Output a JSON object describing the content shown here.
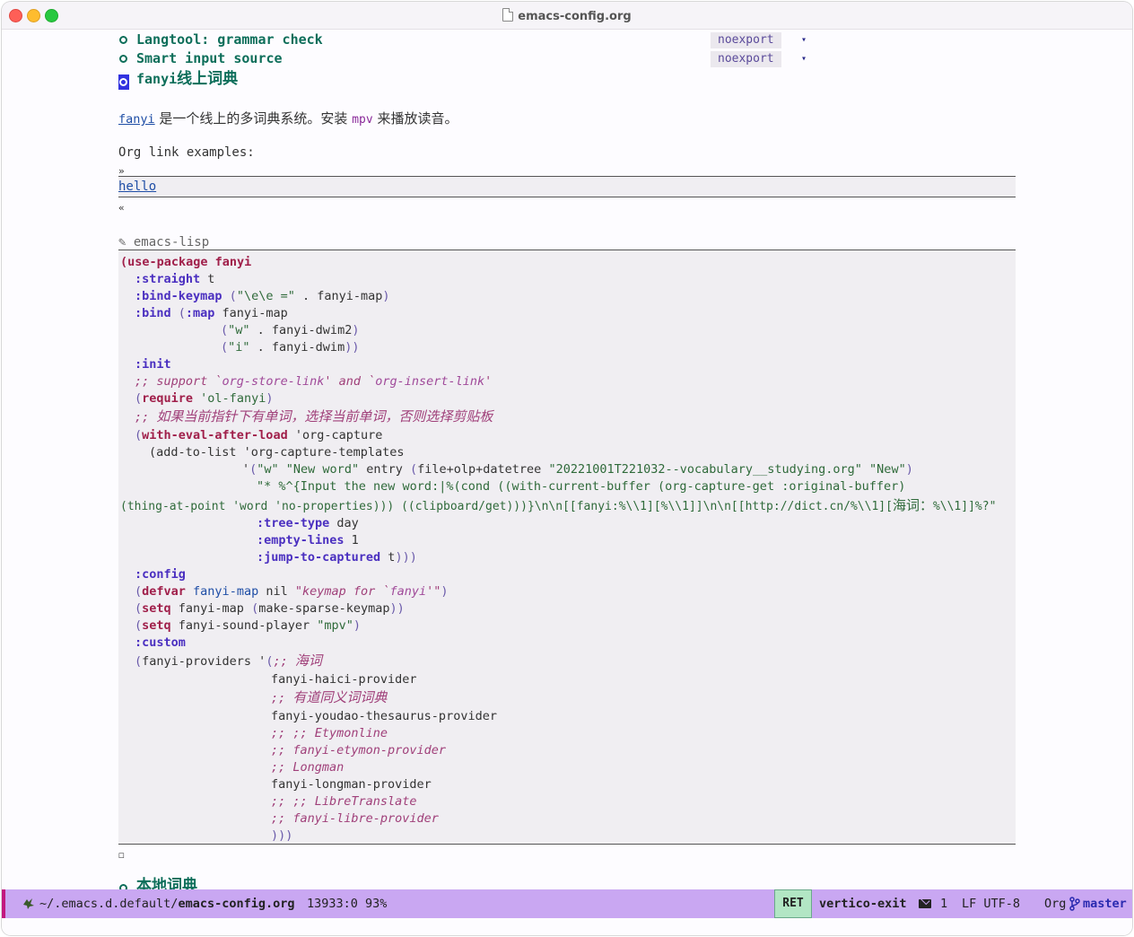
{
  "window": {
    "title": "emacs-config.org"
  },
  "headings": [
    {
      "text": "Langtool: grammar check",
      "tag": "noexport",
      "fold": "▾"
    },
    {
      "text": "Smart input source",
      "tag": "noexport",
      "fold": "▾"
    },
    {
      "prefix": "fanyi",
      "suffix": "线上词典"
    }
  ],
  "intro": {
    "link": "fanyi",
    "text1": " 是一个线上的多词典系统。安装 ",
    "verbatim": "mpv",
    "text2": " 来播放读音。"
  },
  "link_examples": {
    "label": "Org link examples:",
    "open_marker": "»",
    "link": "hello",
    "close_marker": "«"
  },
  "src_block": {
    "icon": "✎",
    "language": "emacs-lisp"
  },
  "code": {
    "l1_kw": "(use-package",
    "l1_name": " fanyi",
    "l2_kw": ":straight",
    "l2_val": " t",
    "l3_kw": ":bind-keymap",
    "l3_p": " (",
    "l3_str": "\"\\e\\e =\"",
    "l3_rest": " . fanyi-map",
    "l3_close": ")",
    "l4_kw": ":bind",
    "l4_p": " (",
    "l4_kw2": ":map",
    "l4_rest": " fanyi-map",
    "l5_p": "(",
    "l5_str": "\"w\"",
    "l5_rest": " . fanyi-dwim2",
    "l5_close": ")",
    "l6_p": "(",
    "l6_str": "\"i\"",
    "l6_rest": " . fanyi-dwim",
    "l6_close": "))",
    "l7_kw": ":init",
    "l8_a": ";; support `",
    "l8_ref1": "org-store-link",
    "l8_b": "' and `",
    "l8_ref2": "org-insert-link",
    "l8_c": "'",
    "l9_p": "(",
    "l9_kw": "require",
    "l9_str": " 'ol-fanyi",
    "l9_close": ")",
    "l10_a": ";; ",
    "l10_cjk": "如果当前指针下有单词，选择当前单词，否则选择剪贴板",
    "l11_p": "(",
    "l11_kw": "with-eval-after-load",
    "l11_rest": " 'org-capture",
    "l12": "(add-to-list 'org-capture-templates",
    "l13_a": "'",
    "l13_p": "(",
    "l13_s1": "\"w\" \"New word\"",
    "l13_b": " entry ",
    "l13_p2": "(",
    "l13_c": "file+olp+datetree ",
    "l13_s2": "\"20221001T221032--vocabulary__studying.org\" \"New\"",
    "l13_close": ")",
    "l14_str": "\"* %^{Input the new word:|%(cond ((with-current-buffer (org-capture-get :original-buffer)",
    "l15_str": "(thing-at-point 'word 'no-properties))) ((clipboard/get)))}\\n\\n[[fanyi:%\\\\1][%\\\\1]]\\n\\n[[http://dict.cn/%\\\\1][",
    "l15_cjk": "海词：",
    "l15_end": "%\\\\1]]%?\"",
    "l16_kw": ":tree-type",
    "l16_val": " day",
    "l17_kw": ":empty-lines",
    "l17_val": " 1",
    "l18_kw": ":jump-to-captured",
    "l18_val": " t",
    "l18_close": ")))",
    "l19_kw": ":config",
    "l20_p": "(",
    "l20_kw": "defvar",
    "l20_fn": " fanyi-map",
    "l20_b": " nil ",
    "l20_doc1": "\"keymap for `",
    "l20_doc2": "fanyi",
    "l20_doc3": "'\"",
    "l20_close": ")",
    "l21_p": "(",
    "l21_kw": "setq",
    "l21_a": " fanyi-map ",
    "l21_p2": "(",
    "l21_b": "make-sparse-keymap",
    "l21_close": "))",
    "l22_p": "(",
    "l22_kw": "setq",
    "l22_a": " fanyi-sound-player ",
    "l22_str": "\"mpv\"",
    "l22_close": ")",
    "l23_kw": ":custom",
    "l24_p": "(",
    "l24_a": "fanyi-providers '",
    "l24_p2": "(",
    "l24_cm": ";; ",
    "l24_cjk": "海词",
    "l25": "fanyi-haici-provider",
    "l26_cm": ";; ",
    "l26_cjk": "有道同义词词典",
    "l27": "fanyi-youdao-thesaurus-provider",
    "l28": ";; ;; Etymonline",
    "l29": ";; fanyi-etymon-provider",
    "l30": ";; Longman",
    "l31": "fanyi-longman-provider",
    "l32": ";; ;; LibreTranslate",
    "l33": ";; fanyi-libre-provider",
    "l34": ")))"
  },
  "after_block": {
    "marker": "◻",
    "partial_heading": "本地词典"
  },
  "modeline": {
    "path_prefix": "~/.emacs.d.default/",
    "filename": "emacs-config.org",
    "position": "13933:0 93%",
    "key": "RET",
    "command": "vertico-exit",
    "mail_count": "1",
    "encoding": "LF UTF-8",
    "major_mode": "Org",
    "branch": "master"
  },
  "colors": {
    "heading": "#0d6e5a",
    "modeline": "#c9a7f2",
    "modeline_edge": "#c2187f",
    "keyword": "#a01f4a",
    "key_box": "#b2e6c4"
  }
}
